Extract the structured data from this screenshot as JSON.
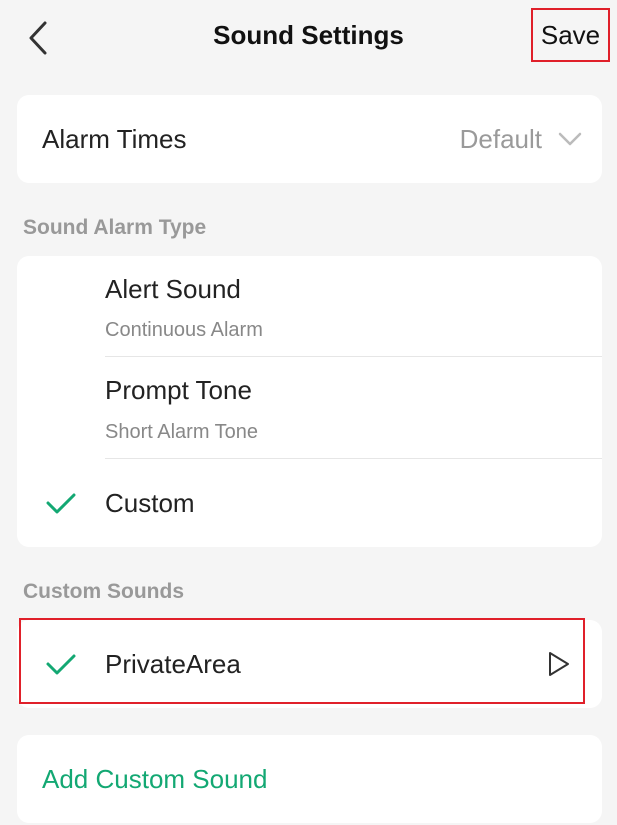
{
  "header": {
    "title": "Sound Settings",
    "save_label": "Save"
  },
  "alarm_times": {
    "label": "Alarm Times",
    "value": "Default"
  },
  "sound_alarm_type": {
    "section_label": "Sound Alarm Type",
    "options": [
      {
        "title": "Alert Sound",
        "subtitle": "Continuous Alarm",
        "selected": false
      },
      {
        "title": "Prompt Tone",
        "subtitle": "Short Alarm Tone",
        "selected": false
      },
      {
        "title": "Custom",
        "selected": true
      }
    ]
  },
  "custom_sounds": {
    "section_label": "Custom Sounds",
    "items": [
      {
        "name": "PrivateArea",
        "selected": true
      }
    ],
    "add_label": "Add Custom Sound"
  },
  "colors": {
    "accent": "#13a873",
    "highlight_border": "#e0202a",
    "background": "#f5f5f5",
    "secondary_text": "#999999"
  },
  "icons": {
    "back": "chevron-left-icon",
    "dropdown": "chevron-down-icon",
    "check": "check-icon",
    "play": "play-icon"
  }
}
